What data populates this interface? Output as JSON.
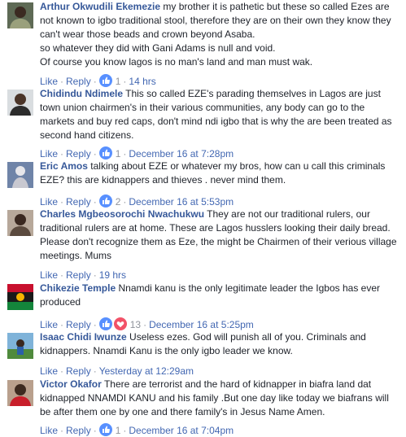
{
  "actions": {
    "like": "Like",
    "reply": "Reply",
    "dot": "·"
  },
  "comments": [
    {
      "author": "Arthur Okwudili Ekemezie",
      "text": "my brother it is pathetic but these so called Ezes are not known to igbo traditional stool, therefore they are on their own they know they can't wear those beads and crown beyond Asaba.\nso whatever they did with Gani Adams is null and void.\nOf course you know lagos is no man's land and man must wak.",
      "reactions": [
        "like"
      ],
      "count": "1",
      "time": "14 hrs"
    },
    {
      "author": "Chidindu Ndimele",
      "text": "This so called EZE's parading themselves in Lagos are just town union chairmen's in their various communities, any body can go to the markets and buy red caps, don't mind ndi igbo that is why the are been treated as second hand citizens.",
      "reactions": [
        "like"
      ],
      "count": "1",
      "time": "December 16 at 7:28pm"
    },
    {
      "author": "Eric Amos",
      "text": "talking about EZE or whatever my bros, how can u call this criminals EZE? this are kidnappers and thieves . never mind them.",
      "reactions": [
        "like"
      ],
      "count": "2",
      "time": "December 16 at 5:53pm"
    },
    {
      "author": "Charles Mgbeosorochi Nwachukwu",
      "text": "They are not our traditional rulers, our traditional rulers are at home. These are Lagos husslers looking their daily bread. Please don't recognize them as Eze, the might be Chairmen of their verious village meetings. Mums",
      "reactions": [],
      "count": "",
      "time": "19 hrs"
    },
    {
      "author": "Chikezie Temple",
      "text": "Nnamdi kanu is the only legitimate leader the Igbos has ever produced",
      "reactions": [
        "like",
        "love"
      ],
      "count": "13",
      "time": "December 16 at 5:25pm"
    },
    {
      "author": "Isaac Chidi Iwunze",
      "text": "Useless ezes. God will punish all of you. Criminals and kidnappers. Nnamdi Kanu is the only igbo leader we know.",
      "reactions": [],
      "count": "",
      "time": "Yesterday at 12:29am"
    },
    {
      "author": "Victor Okafor",
      "text": "There are terrorist and the hard of kidnapper in biafra land dat kidnapped NNAMDI KANU and his family .But one day like today we biafrans will be after them one by one and there family's in Jesus Name Amen.",
      "reactions": [
        "like"
      ],
      "count": "1",
      "time": "December 16 at 7:04pm"
    }
  ]
}
